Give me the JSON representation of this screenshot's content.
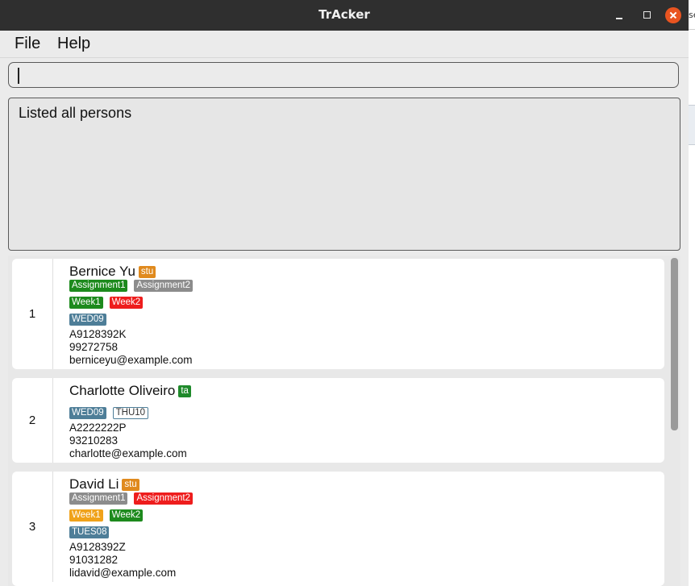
{
  "window": {
    "title": "TrAcker"
  },
  "behind": {
    "text": "se"
  },
  "menu": {
    "file": "File",
    "help": "Help"
  },
  "command": {
    "value": ""
  },
  "result": {
    "text": "Listed all persons"
  },
  "colors": {
    "role_stu": "#e08a1e",
    "role_ta": "#1f8a2b",
    "green": "#1d8a1d",
    "gray": "#8c8c8c",
    "red": "#ee1d1d",
    "orange": "#f0a21a",
    "slot": "#4e7e98"
  },
  "persons": [
    {
      "index": "1",
      "name": "Bernice Yu",
      "role": {
        "label": "stu",
        "color": "#e08a1e"
      },
      "assignments": [
        {
          "label": "Assignment1",
          "color": "#1d8a1d"
        },
        {
          "label": "Assignment2",
          "color": "#8c8c8c"
        }
      ],
      "weeks": [
        {
          "label": "Week1",
          "color": "#1d8a1d"
        },
        {
          "label": "Week2",
          "color": "#ee1d1d"
        }
      ],
      "slots": [
        {
          "label": "WED09",
          "style": "filled"
        }
      ],
      "matric": "A9128392K",
      "phone": "99272758",
      "email": "berniceyu@example.com"
    },
    {
      "index": "2",
      "name": "Charlotte Oliveiro",
      "role": {
        "label": "ta",
        "color": "#1f8a2b"
      },
      "assignments": [],
      "weeks": [],
      "slots": [
        {
          "label": "WED09",
          "style": "filled"
        },
        {
          "label": "THU10",
          "style": "outline"
        }
      ],
      "matric": "A2222222P",
      "phone": "93210283",
      "email": "charlotte@example.com"
    },
    {
      "index": "3",
      "name": "David Li",
      "role": {
        "label": "stu",
        "color": "#e08a1e"
      },
      "assignments": [
        {
          "label": "Assignment1",
          "color": "#8c8c8c"
        },
        {
          "label": "Assignment2",
          "color": "#ee1d1d"
        }
      ],
      "weeks": [
        {
          "label": "Week1",
          "color": "#f0a21a"
        },
        {
          "label": "Week2",
          "color": "#1d8a1d"
        }
      ],
      "slots": [
        {
          "label": "TUES08",
          "style": "filled"
        }
      ],
      "matric": "A9128392Z",
      "phone": "91031282",
      "email": "lidavid@example.com"
    }
  ]
}
